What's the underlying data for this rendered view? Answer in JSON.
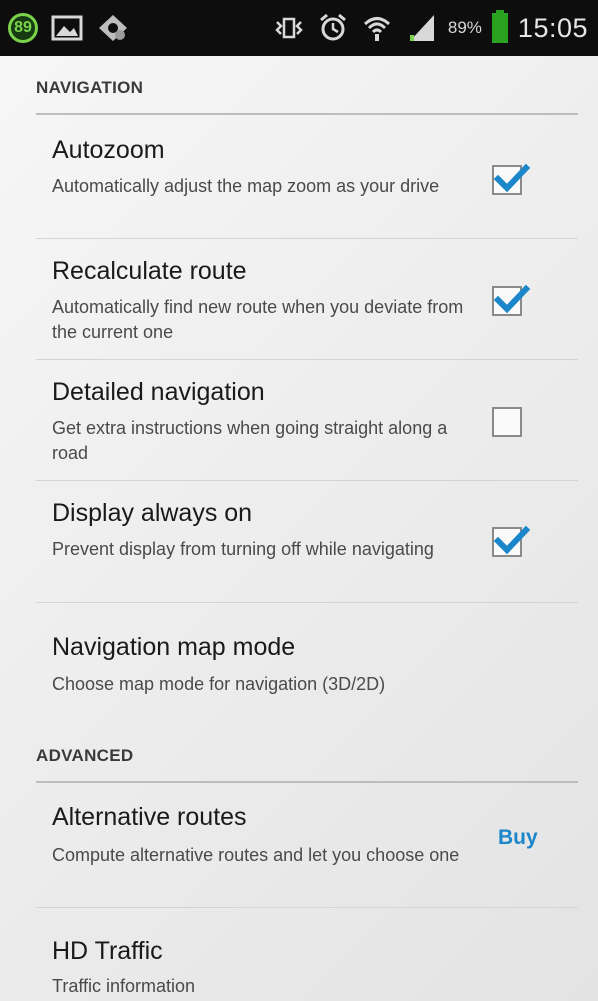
{
  "status_bar": {
    "notification_count": "89",
    "battery_percent": "89%",
    "time": "15:05",
    "icons": [
      "notification-badge",
      "image-icon",
      "settings-gear-icon",
      "vibrate-icon",
      "alarm-icon",
      "wifi-icon",
      "signal-icon",
      "battery-icon"
    ],
    "accent_green": "#7bd34b"
  },
  "sections": {
    "navigation": {
      "header": "NAVIGATION",
      "items": [
        {
          "title": "Autozoom",
          "summary": "Automatically adjust the map zoom as your drive",
          "checked": true
        },
        {
          "title": "Recalculate route",
          "summary": "Automatically find new route when you deviate from the current one",
          "checked": true
        },
        {
          "title": "Detailed navigation",
          "summary": "Get extra instructions when going straight along a road",
          "checked": false
        },
        {
          "title": "Display always on",
          "summary": "Prevent display from turning off while navigating",
          "checked": true
        },
        {
          "title": "Navigation map mode",
          "summary": "Choose map mode for navigation (3D/2D)"
        }
      ]
    },
    "advanced": {
      "header": "ADVANCED",
      "items": [
        {
          "title": "Alternative routes",
          "summary": "Compute alternative routes and let you choose one",
          "action": "Buy"
        },
        {
          "title": "HD Traffic",
          "summary": "Traffic information"
        }
      ]
    }
  },
  "colors": {
    "check_blue": "#1b86c9",
    "buy_blue": "#1b86c9"
  }
}
